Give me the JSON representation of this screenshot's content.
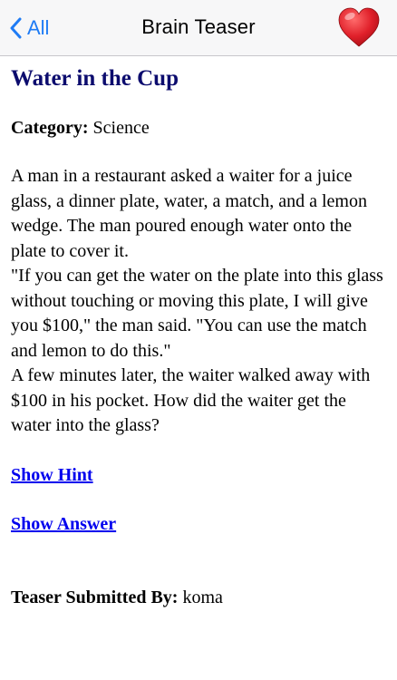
{
  "navbar": {
    "back_label": "All",
    "title": "Brain Teaser",
    "favorite_icon": "heart-icon",
    "accent_color": "#1f7cf5",
    "heart_color": "#e0202a"
  },
  "teaser": {
    "title": "Water in the Cup",
    "category_label": "Category:",
    "category_value": "Science",
    "paragraphs": [
      "A man in a restaurant asked a waiter for a juice glass, a dinner plate, water, a match, and a lemon wedge. The man poured enough water onto the plate to cover it.",
      "\"If you can get the water on the plate into this glass without touching or moving this plate, I will give you $100,\" the man said. \"You can use the match and lemon to do this.\"",
      "A few minutes later, the waiter walked away with $100 in his pocket. How did the waiter get the water into the glass?"
    ],
    "show_hint_label": "Show Hint",
    "show_answer_label": "Show Answer",
    "submitted_label": "Teaser Submitted By:",
    "submitted_value": "koma"
  }
}
